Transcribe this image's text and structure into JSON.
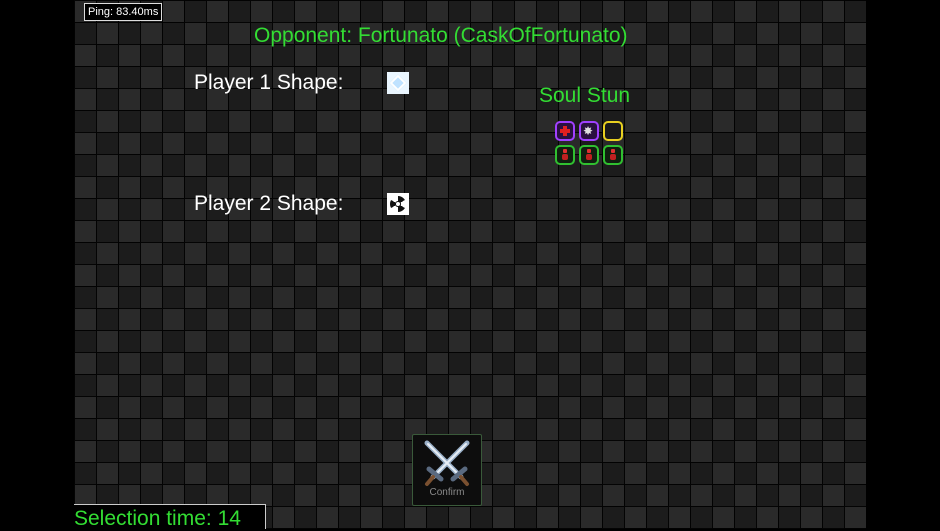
{
  "ping": "Ping: 83.40ms",
  "opponent": "Opponent: Fortunato (CaskOfFortunato)",
  "player1": {
    "label": "Player 1 Shape:",
    "shape_icon": "diamond-icon"
  },
  "player2": {
    "label": "Player 2 Shape:",
    "shape_icon": "radiation-icon"
  },
  "ability": {
    "name": "Soul Stun",
    "top_row": [
      "red-cross-icon",
      "star-icon",
      "empty-slot"
    ],
    "bottom_row": [
      "red-rune-icon",
      "red-rune-icon",
      "red-rune-icon"
    ]
  },
  "confirm": {
    "label": "Confirm",
    "icon": "crossed-swords-icon"
  },
  "selection_time": "Selection time: 14",
  "colors": {
    "accent_green": "#33dd33",
    "board_dark": "#1c1c1c",
    "board_light": "#2a2a2a"
  }
}
